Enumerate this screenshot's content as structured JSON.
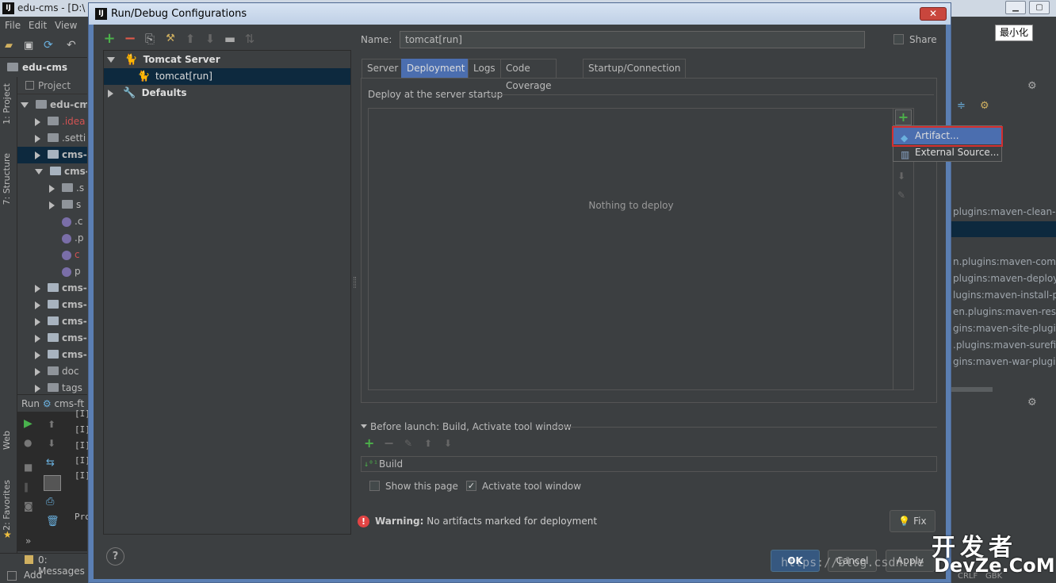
{
  "ide": {
    "title": "edu-cms - [D:\\",
    "menu": [
      "File",
      "Edit",
      "View"
    ],
    "breadcrumb": "edu-cms",
    "side_tabs": [
      "1: Project",
      "7: Structure",
      "Web",
      "2: Favorites"
    ],
    "project_label": "Project",
    "tree": [
      {
        "label": "edu-cm",
        "type": "root"
      },
      {
        "label": ".idea",
        "type": "folder"
      },
      {
        "label": ".setti",
        "type": "folder"
      },
      {
        "label": "cms-",
        "type": "module"
      },
      {
        "label": "cms-",
        "type": "module"
      },
      {
        "label": ".s",
        "type": "folder"
      },
      {
        "label": "s",
        "type": "folder"
      },
      {
        "label": ".c",
        "type": "file"
      },
      {
        "label": ".p",
        "type": "file"
      },
      {
        "label": "c",
        "type": "file"
      },
      {
        "label": "p",
        "type": "file"
      },
      {
        "label": "cms-",
        "type": "module"
      },
      {
        "label": "cms-",
        "type": "module"
      },
      {
        "label": "cms-",
        "type": "module"
      },
      {
        "label": "cms-",
        "type": "module"
      },
      {
        "label": "cms-",
        "type": "module"
      },
      {
        "label": "doc",
        "type": "folder"
      },
      {
        "label": "tags",
        "type": "folder"
      }
    ],
    "run_label": "Run",
    "run_config": "cms-ft",
    "run_lines": [
      "[I]",
      "[I]",
      "[I]",
      "[I]",
      "[I]",
      "Pro"
    ],
    "bottom_messages": "0: Messages",
    "bottom_add": "Add",
    "tooltip": "最小化",
    "maven_lines": [
      "plugins:maven-clean-plu",
      "n.plugins:maven-comp",
      "plugins:maven-deploy-",
      "lugins:maven-install-pl",
      "en.plugins:maven-reso",
      "gins:maven-site-plugin",
      ".plugins:maven-surefir",
      "gins:maven-war-plugin"
    ],
    "status_bits": [
      "CRLF",
      "GBK"
    ]
  },
  "dialog": {
    "title": "Run/Debug Configurations",
    "close_label": "✕",
    "tree": {
      "group": "Tomcat Server",
      "item": "tomcat[run]",
      "defaults": "Defaults"
    },
    "name_label": "Name:",
    "name_value": "tomcat[run]",
    "share_label": "Share",
    "tabs": [
      "Server",
      "Deployment",
      "Logs",
      "Code Coverage",
      "Startup/Connection"
    ],
    "active_tab": "Deployment",
    "deploy_label": "Deploy at the server startup",
    "empty_text": "Nothing to deploy",
    "popup": [
      "Artifact...",
      "External Source..."
    ],
    "before_launch": "Before launch: Build, Activate tool window",
    "build_item": "Build",
    "show_page": "Show this page",
    "activate_tool": "Activate tool window",
    "warning_bold": "Warning:",
    "warning_text": "No artifacts marked for deployment",
    "fix_label": "Fix",
    "help_label": "?",
    "ok_label": "OK",
    "cancel_label": "Cancel",
    "apply_label": "Apply"
  },
  "watermark": {
    "url": "https://blog.csdn.ne",
    "logo_cn": "开发者",
    "logo_en": "DevZe.CoM"
  },
  "colors": {
    "accent": "#4b6eaf",
    "selection": "#0d293e",
    "add_green": "#4cb14a",
    "warning": "#e24444",
    "highlight_frame": "#d32f2f"
  }
}
